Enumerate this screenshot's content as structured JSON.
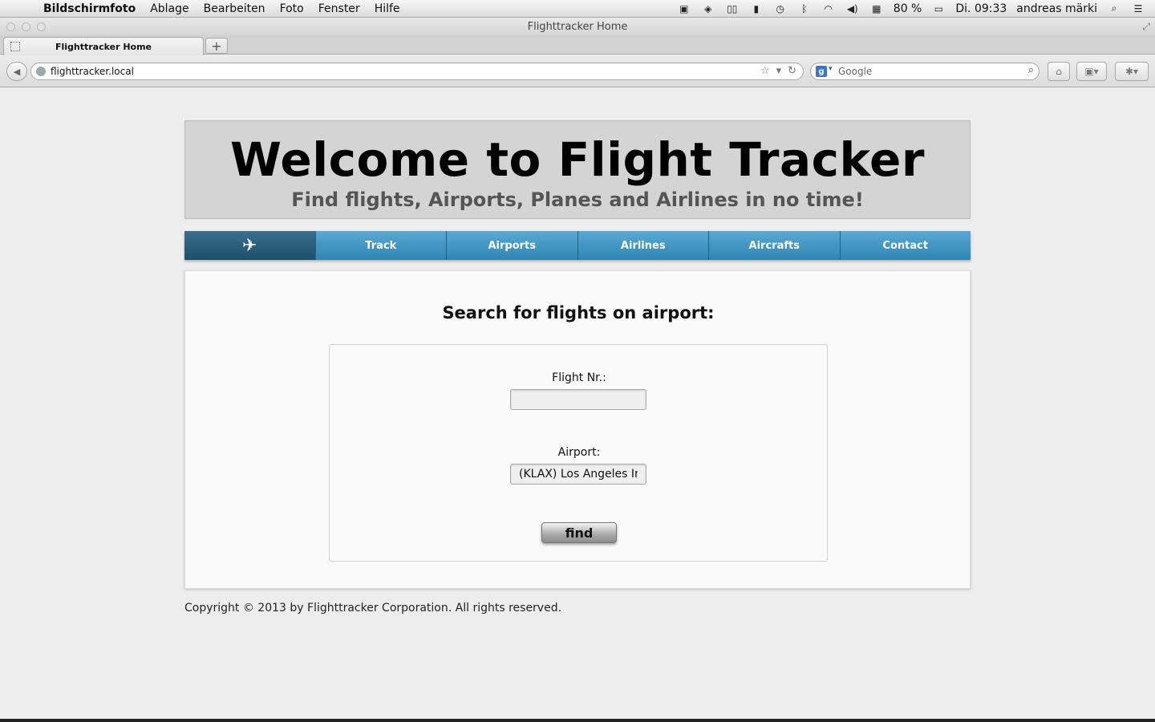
{
  "menubar": {
    "app": "Bildschirmfoto",
    "items": [
      "Ablage",
      "Bearbeiten",
      "Foto",
      "Fenster",
      "Hilfe"
    ],
    "battery": "80 %",
    "clock": "Di. 09:33",
    "user": "andreas märki"
  },
  "browser": {
    "window_title": "Flighttracker Home",
    "tab_title": "Flighttracker Home",
    "new_tab": "+",
    "url": "flighttracker.local",
    "search_placeholder": "Google"
  },
  "page": {
    "title": "Welcome to Flight Tracker",
    "subtitle": "Find flights, Airports, Planes and Airlines in no time!",
    "nav": {
      "home_icon": "✈",
      "items": [
        "Track",
        "Airports",
        "Airlines",
        "Aircrafts",
        "Contact"
      ]
    },
    "search": {
      "heading": "Search for flights on airport:",
      "flight_label": "Flight Nr.:",
      "flight_value": "",
      "airport_label": "Airport:",
      "airport_value": "(KLAX) Los Angeles Intl",
      "find_label": "find"
    },
    "footer": "Copyright © 2013 by Flighttracker Corporation. All rights reserved."
  },
  "colors": {
    "nav_blue": "#3a93c2",
    "nav_home": "#2a5d7a",
    "header_bg": "#d4d4d4"
  }
}
